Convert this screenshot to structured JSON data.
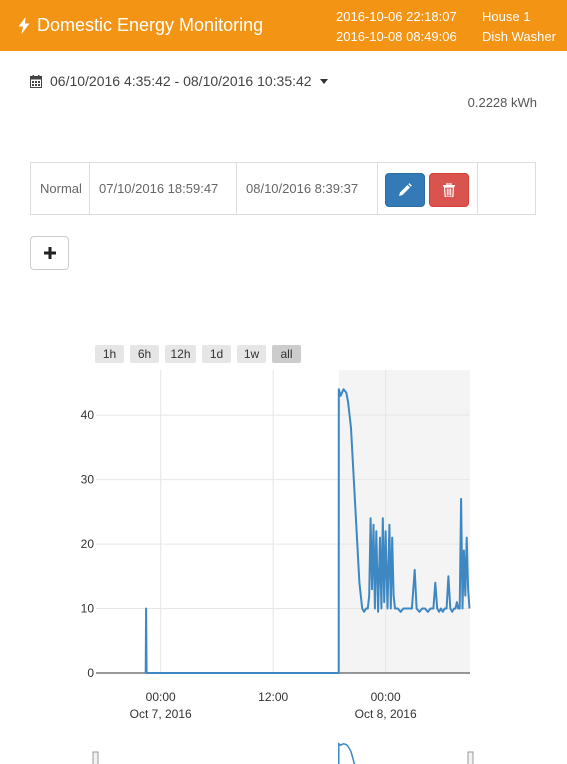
{
  "header": {
    "title": "Domestic Energy Monitoring",
    "start_time": "2016-10-06 22:18:07",
    "end_time": "2016-10-08 08:49:06",
    "house": "House 1",
    "appliance": "Dish Washer",
    "bg_color": "#f39415"
  },
  "date_range": {
    "label": "06/10/2016 4:35:42 - 08/10/2016 10:35:42"
  },
  "energy": {
    "value": "0.2228 kWh"
  },
  "periods": [
    {
      "label": "Normal",
      "start": "07/10/2016 18:59:47",
      "end": "08/10/2016 8:39:37"
    }
  ],
  "icons": {
    "brand": "bolt-icon",
    "calendar": "calendar-icon",
    "edit": "pencil-icon",
    "delete": "trash-icon",
    "add": "plus-icon"
  },
  "range_selector": [
    {
      "label": "1h",
      "active": false
    },
    {
      "label": "6h",
      "active": false
    },
    {
      "label": "12h",
      "active": false
    },
    {
      "label": "1d",
      "active": false
    },
    {
      "label": "1w",
      "active": false
    },
    {
      "label": "all",
      "active": true
    }
  ],
  "chart_data": {
    "type": "line",
    "y_ticks": [
      "0",
      "10",
      "20",
      "30",
      "40"
    ],
    "ylim": [
      0,
      47
    ],
    "x_range_hours": [
      -6.9,
      33.0
    ],
    "x_ticks": [
      {
        "hour": 0,
        "time": "00:00",
        "date": "Oct 7, 2016"
      },
      {
        "hour": 12,
        "time": "12:00",
        "date": ""
      },
      {
        "hour": 24,
        "time": "00:00",
        "date": "Oct 8, 2016"
      }
    ],
    "grid": true,
    "line_color": "#3d88c2",
    "band_color": "#f4f4f4",
    "highlight_band": {
      "from_hour": 19.0,
      "to_hour": 33.0
    },
    "series": [
      {
        "x": [
          -1.6,
          -1.55,
          -1.5,
          18.99,
          19.0,
          19.2,
          19.5,
          19.8,
          20.0,
          20.3,
          20.6,
          20.9,
          21.2,
          21.5,
          21.7,
          21.9,
          22.1,
          22.25,
          22.4,
          22.55,
          22.7,
          22.85,
          23.0,
          23.2,
          23.4,
          23.55,
          23.7,
          23.85,
          24.0,
          24.2,
          24.4,
          24.55,
          24.7,
          24.85,
          25.0,
          25.3,
          25.6,
          25.9,
          26.2,
          26.5,
          26.8,
          27.1,
          27.3,
          27.6,
          27.9,
          28.2,
          28.5,
          28.8,
          29.1,
          29.3,
          29.5,
          29.7,
          29.9,
          30.1,
          30.3,
          30.5,
          30.7,
          30.9,
          31.1,
          31.3,
          31.45,
          31.6,
          31.75,
          31.9,
          32.05,
          32.2,
          32.35,
          32.5,
          32.65,
          32.8,
          32.95
        ],
        "y": [
          0,
          10,
          0,
          0,
          44,
          43,
          44,
          43.5,
          42,
          38,
          30,
          22,
          14,
          10,
          9.5,
          10,
          10,
          12,
          24,
          13,
          23,
          10,
          22,
          9.5,
          21,
          10,
          24,
          11,
          22,
          10,
          23,
          10,
          21,
          12,
          10,
          10,
          9.5,
          10,
          10,
          10,
          10,
          16,
          10,
          9.5,
          10,
          10,
          9.5,
          10,
          10,
          14,
          10,
          9.5,
          10,
          9.5,
          10,
          10,
          15,
          10,
          9.5,
          10,
          10,
          11,
          10,
          10,
          27,
          10,
          19,
          12,
          21,
          13,
          10
        ]
      }
    ]
  },
  "navigator": {
    "x_range_hours": [
      -6.9,
      33.0
    ],
    "ylim": [
      0,
      47
    ],
    "handles": [
      "left",
      "right"
    ]
  }
}
